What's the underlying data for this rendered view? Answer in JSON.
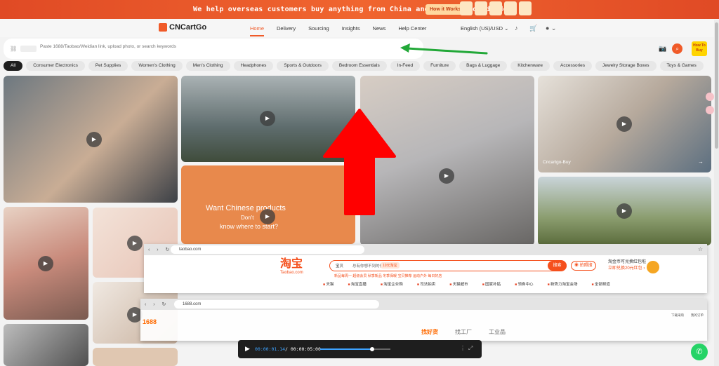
{
  "banner": {
    "text": "We help overseas customers buy anything from China and ship it worldwide.",
    "button": "How it Works"
  },
  "header": {
    "logo": "CNCartGo",
    "nav": [
      "Home",
      "Delivery",
      "Sourcing",
      "Insights",
      "News",
      "Help Center"
    ],
    "language": "English (US)/USD"
  },
  "search": {
    "placeholder": "Paste 1688/Taobao/Weidian link, upload photo, or search keywords",
    "how_to": "How To Buy"
  },
  "categories": [
    "All",
    "Consumer Electronics",
    "Pet Supplies",
    "Women's Clothing",
    "Men's Clothing",
    "Headphones",
    "Sports & Outdoors",
    "Bedroom Essentials",
    "In-Feed",
    "Furniture",
    "Bags & Luggage",
    "Kitchenware",
    "Accessories",
    "Jewelry Storage Boxes",
    "Toys & Games"
  ],
  "tiles": {
    "map_title": "Want Chinese products",
    "map_subtitle_1": "Don't",
    "map_subtitle_2": "know where to start?",
    "buy_label": "Cncartgo-Buy"
  },
  "taobao": {
    "url": "taobao.com",
    "logo": "淘宝",
    "logo_sub": "Taobao.com",
    "search_prefix": "宝贝",
    "search_hint": "总有你想不到的低价",
    "search_tag": "10元淘宝",
    "search_button": "搜索",
    "photo_search": "拍照搜",
    "promo_line1": "淘金币可兑换红包啦",
    "promo_line2": "立即兑换20元红包 ›",
    "hot_words": "新品每周一  超级会员  秋季新品  冬季保暖  宝贝推荐  运动户外  每日好店",
    "menu": [
      "天猫",
      "淘宝直播",
      "淘宝企业购",
      "司法拍卖",
      "天猫超市",
      "国家补贴",
      "领券中心",
      "新势力淘宝会场",
      "全部频道"
    ]
  },
  "alibaba": {
    "url": "1688.com",
    "logo": "1688",
    "tabs": [
      "找好货",
      "找工厂",
      "工业品"
    ],
    "tools": [
      "下载采购",
      "我的订单"
    ]
  },
  "video": {
    "current": "00:00:01.14",
    "total": "00:00:05:00",
    "progress": 0.74
  },
  "colors": {
    "brand": "#f05a28",
    "taobao": "#f5501d",
    "alibaba": "#ff6a00",
    "whatsapp": "#25d366",
    "annotation_green": "#22a838",
    "annotation_red": "#ff0000"
  }
}
